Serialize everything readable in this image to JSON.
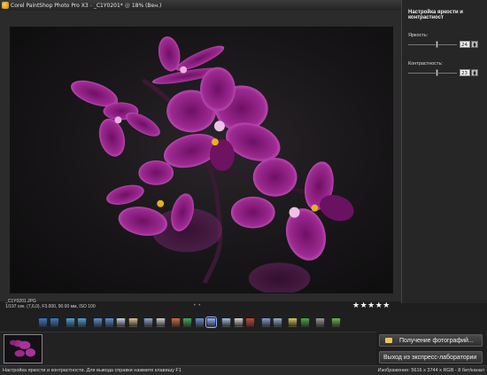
{
  "window": {
    "title": "Corel PaintShop Photo Pro X3",
    "filename": "_C1Y0201*",
    "zoom": "18% (Вен.)"
  },
  "panel": {
    "title": "Настройка яркости и контрастност",
    "brightness_label": "Яркость:",
    "brightness_value": "24",
    "brightness_level": 0.6,
    "contrast_label": "Контрастность:",
    "contrast_value": "23",
    "contrast_level": 0.6
  },
  "info": {
    "filename": "_C1Y0201.JPG",
    "details": "1/197 сек. (7,6,0), F3.000, 90.00 мм, ISO 100"
  },
  "nav_dots": "• •",
  "rating": {
    "stars": 5,
    "text": "★★★★★"
  },
  "toolbar": {
    "icons": [
      "save-icon",
      "save-as-icon",
      "undo-icon",
      "redo-icon",
      "actual-size-icon",
      "fit-icon",
      "zoom-icon",
      "pan-icon",
      "frame-icon",
      "crop-icon",
      "photo-fix-icon",
      "color-icon",
      "levels-icon",
      "brightness-contrast-icon",
      "sharpen-icon",
      "text-icon",
      "red-eye-icon",
      "retouch-icon",
      "clone-icon",
      "tag-icon",
      "flag-icon",
      "delete-icon",
      "edit-icon"
    ]
  },
  "buttons": {
    "get_photos": "Получение фотографий...",
    "exit_lab": "Выход из экспресс-лаборатории"
  },
  "status": {
    "left": "Настройка яркости и контрастности. Для вывода справки нажмите клавишу F1",
    "right": "Изображение: 5616 x 3744 x RGB - 8 бит/канал"
  },
  "colors": {
    "orchid": "#9b2a8c",
    "orchid_light": "#d46ad0",
    "background": "#1e1e1e"
  }
}
